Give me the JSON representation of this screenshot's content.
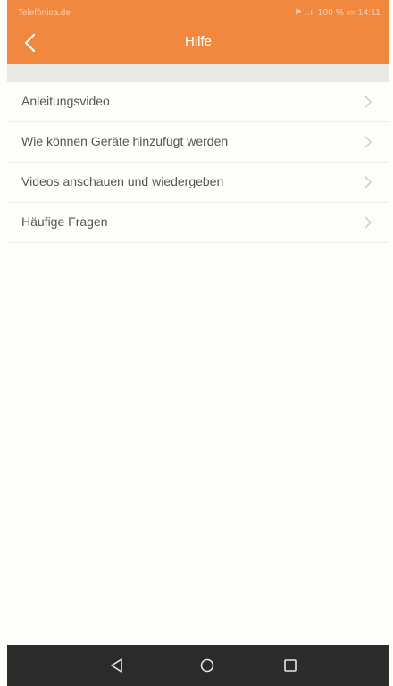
{
  "status_bar": {
    "carrier": "Telefónica.de",
    "right": "⚑ ..ıl 100 % ▭ 14:11"
  },
  "header": {
    "title": "Hilfe",
    "back_icon": "chevron-left-icon"
  },
  "menu": {
    "items": [
      {
        "label": "Anleitungsvideo"
      },
      {
        "label": "Wie können Geräte hinzufügt werden"
      },
      {
        "label": "Videos anschauen und wiedergeben"
      },
      {
        "label": "Häufige Fragen"
      }
    ],
    "chevron_icon": "chevron-right-icon"
  },
  "navigation_bar": {
    "back_icon": "triangle-back-icon",
    "home_icon": "circle-home-icon",
    "recent_icon": "square-recents-icon"
  },
  "colors": {
    "accent": "#f0883f",
    "background": "#fdfdf9",
    "navbar": "#2b2b2b",
    "text": "#555555"
  }
}
